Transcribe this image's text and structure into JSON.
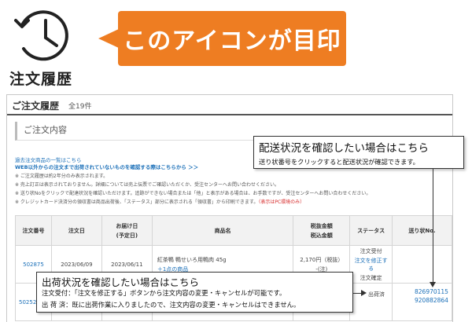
{
  "banner": {
    "icon_name": "clock-history-icon",
    "icon_label": "注文履歴",
    "callout_text": "このアイコンが目印",
    "accent_color": "#ee7d22"
  },
  "page": {
    "title": "ご注文履歴",
    "count": "全19件",
    "section_title": "ご注文内容",
    "links": [
      "過去注文商品の一覧はこちら",
      "WEB以外からの注文まで出荷されていないものを確認する際はこちらから ＞＞"
    ],
    "notes": [
      "※ ご注文履歴は約2年分のみ表示されます。",
      "※ 売上訂正は表示されておりません。詳細については売上伝票でご確認いただくか、受注センターへお問い合わせください。",
      "※ 送り状Noをクリックで配達状況を確認いただけます。追跡ができない場合または「他」と表示がある場合は、お手数ですが、受注センターへお問い合わせください。",
      "※ クレジットカード決済分の領収書は商品出荷後、「ステータス」部分に表示される「領収書」から印刷できます。"
    ],
    "note_red": "（表示はPC環境のみ）"
  },
  "table": {
    "headers": {
      "order_no": "注文番号",
      "order_date": "注文日",
      "delivery": "お届け日",
      "delivery_sub": "(予定日)",
      "product": "商品名",
      "price": "税抜金額",
      "price_sub": "税込金額",
      "status": "ステータス",
      "tracking": "送り状No."
    },
    "row1": {
      "order_no": "502875",
      "order_date": "2023/06/09",
      "delivery": "2023/06/11",
      "product": "紅茶鴨 鴨せいろ用鴨肉 45g",
      "more": "＋1点の商品",
      "price": "2,170円（税抜）",
      "price_sub": "-(注)",
      "status": "注文受付",
      "status_link": "注文を修正する",
      "status_sub": "注文確定"
    },
    "row2": {
      "order_no": "50252",
      "status": "出荷済",
      "tracking": [
        "826970115",
        "920882864"
      ]
    }
  },
  "callout_shipping": {
    "title": "配送状況を確認したい場合はこちら",
    "text": "送り状番号をクリックすると配送状況が確認できます。"
  },
  "callout_status": {
    "title": "出荷状況を確認したい場合はこちら",
    "line1": "注文受付：「注文を修正する」ボタンから注文内容の変更・キャンセルが可能です。",
    "line2": "出 荷 済：既に出荷作業に入りましたので、注文内容の変更・キャンセルはできません。"
  }
}
